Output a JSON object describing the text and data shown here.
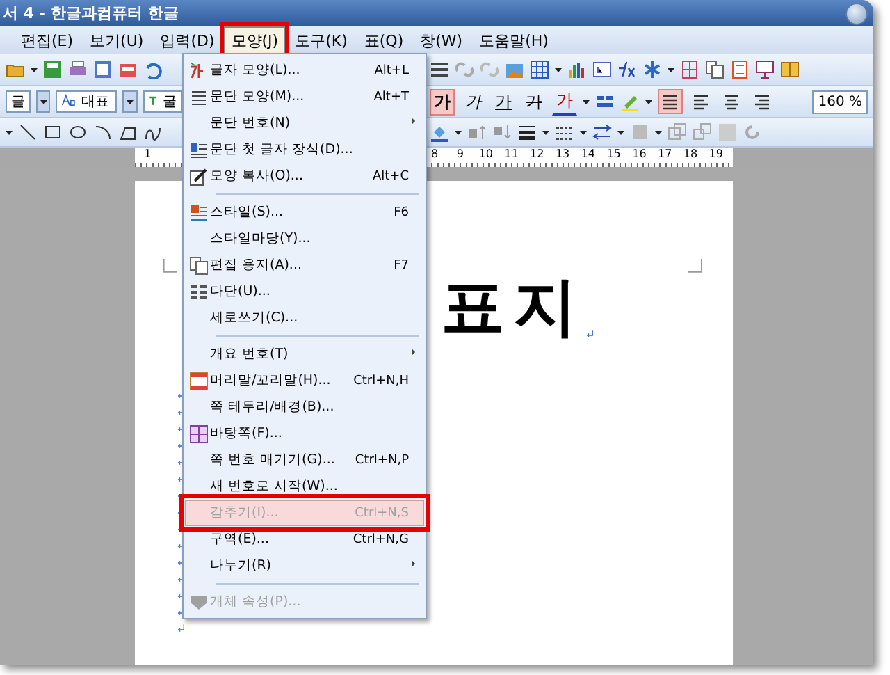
{
  "window": {
    "title": "서 4 - 한글과컴퓨터 한글"
  },
  "menubar": [
    {
      "label": "편집(E)",
      "selected": false,
      "marked": false
    },
    {
      "label": "보기(U)",
      "selected": false,
      "marked": false
    },
    {
      "label": "입력(D)",
      "selected": false,
      "marked": false
    },
    {
      "label": "모양(J)",
      "selected": true,
      "marked": true
    },
    {
      "label": "도구(K)",
      "selected": false,
      "marked": false
    },
    {
      "label": "표(Q)",
      "selected": false,
      "marked": false
    },
    {
      "label": "창(W)",
      "selected": false,
      "marked": false
    },
    {
      "label": "도움말(H)",
      "selected": false,
      "marked": false
    }
  ],
  "toolbar": {
    "style_list": "글",
    "style_name": "대표",
    "font_name": "굴",
    "format_buttons": [
      {
        "label": "가",
        "selected": true
      },
      {
        "label": "가",
        "selected": false
      },
      {
        "label": "가",
        "selected": false
      },
      {
        "label": "가",
        "selected": false
      },
      {
        "label": "가",
        "selected": false
      }
    ],
    "align_buttons": [
      {
        "selected": true
      },
      {
        "selected": false
      },
      {
        "selected": false
      },
      {
        "selected": false
      }
    ],
    "zoom": "160 %"
  },
  "ruler": {
    "labels": [
      "1",
      "8",
      "9",
      "10",
      "11",
      "12",
      "13",
      "14",
      "15",
      "16",
      "17",
      "18",
      "19"
    ]
  },
  "menu": [
    {
      "kind": "item",
      "label": "글자 모양(L)...",
      "shortcut": "Alt+L",
      "icon": true,
      "submenu": false,
      "disabled": false,
      "selected": false,
      "marked": false
    },
    {
      "kind": "item",
      "label": "문단 모양(M)...",
      "shortcut": "Alt+T",
      "icon": true,
      "submenu": false,
      "disabled": false,
      "selected": false,
      "marked": false
    },
    {
      "kind": "item",
      "label": "문단 번호(N)",
      "icon": false,
      "submenu": true,
      "disabled": false,
      "selected": false,
      "marked": false
    },
    {
      "kind": "item",
      "label": "문단 첫 글자 장식(D)...",
      "icon": true,
      "submenu": false,
      "disabled": false,
      "selected": false,
      "marked": false
    },
    {
      "kind": "item",
      "label": "모양 복사(O)...",
      "shortcut": "Alt+C",
      "icon": true,
      "submenu": false,
      "disabled": false,
      "selected": false,
      "marked": false
    },
    {
      "kind": "separator"
    },
    {
      "kind": "item",
      "label": "스타일(S)...",
      "shortcut": "F6",
      "icon": true,
      "submenu": false,
      "disabled": false,
      "selected": false,
      "marked": false
    },
    {
      "kind": "item",
      "label": "스타일마당(Y)...",
      "icon": false,
      "submenu": false,
      "disabled": false,
      "selected": false,
      "marked": false
    },
    {
      "kind": "item",
      "label": "편집 용지(A)...",
      "shortcut": "F7",
      "icon": true,
      "submenu": false,
      "disabled": false,
      "selected": false,
      "marked": false
    },
    {
      "kind": "item",
      "label": "다단(U)...",
      "icon": true,
      "submenu": false,
      "disabled": false,
      "selected": false,
      "marked": false
    },
    {
      "kind": "item",
      "label": "세로쓰기(C)...",
      "icon": false,
      "submenu": false,
      "disabled": false,
      "selected": false,
      "marked": false
    },
    {
      "kind": "separator"
    },
    {
      "kind": "item",
      "label": "개요 번호(T)",
      "icon": false,
      "submenu": true,
      "disabled": false,
      "selected": false,
      "marked": false
    },
    {
      "kind": "item",
      "label": "머리말/꼬리말(H)...",
      "shortcut": "Ctrl+N,H",
      "icon": true,
      "submenu": false,
      "disabled": false,
      "selected": false,
      "marked": false
    },
    {
      "kind": "item",
      "label": "쪽 테두리/배경(B)...",
      "icon": false,
      "submenu": false,
      "disabled": false,
      "selected": false,
      "marked": false
    },
    {
      "kind": "item",
      "label": "바탕쪽(F)...",
      "icon": true,
      "submenu": false,
      "disabled": false,
      "selected": false,
      "marked": false
    },
    {
      "kind": "item",
      "label": "쪽 번호 매기기(G)...",
      "shortcut": "Ctrl+N,P",
      "icon": false,
      "submenu": false,
      "disabled": false,
      "selected": false,
      "marked": false
    },
    {
      "kind": "item",
      "label": "새 번호로 시작(W)...",
      "icon": false,
      "submenu": false,
      "disabled": false,
      "selected": false,
      "marked": false
    },
    {
      "kind": "item",
      "label": "감추기(I)...",
      "shortcut": "Ctrl+N,S",
      "icon": false,
      "submenu": false,
      "disabled": true,
      "selected": true,
      "marked": true
    },
    {
      "kind": "item",
      "label": "구역(E)...",
      "shortcut": "Ctrl+N,G",
      "icon": false,
      "submenu": false,
      "disabled": false,
      "selected": false,
      "marked": false
    },
    {
      "kind": "item",
      "label": "나누기(R)",
      "icon": false,
      "submenu": true,
      "disabled": false,
      "selected": false,
      "marked": false
    },
    {
      "kind": "separator"
    },
    {
      "kind": "item",
      "label": "개체 속성(P)...",
      "icon": true,
      "submenu": false,
      "disabled": true,
      "selected": false,
      "marked": false
    }
  ],
  "document": {
    "heading": "표지"
  }
}
